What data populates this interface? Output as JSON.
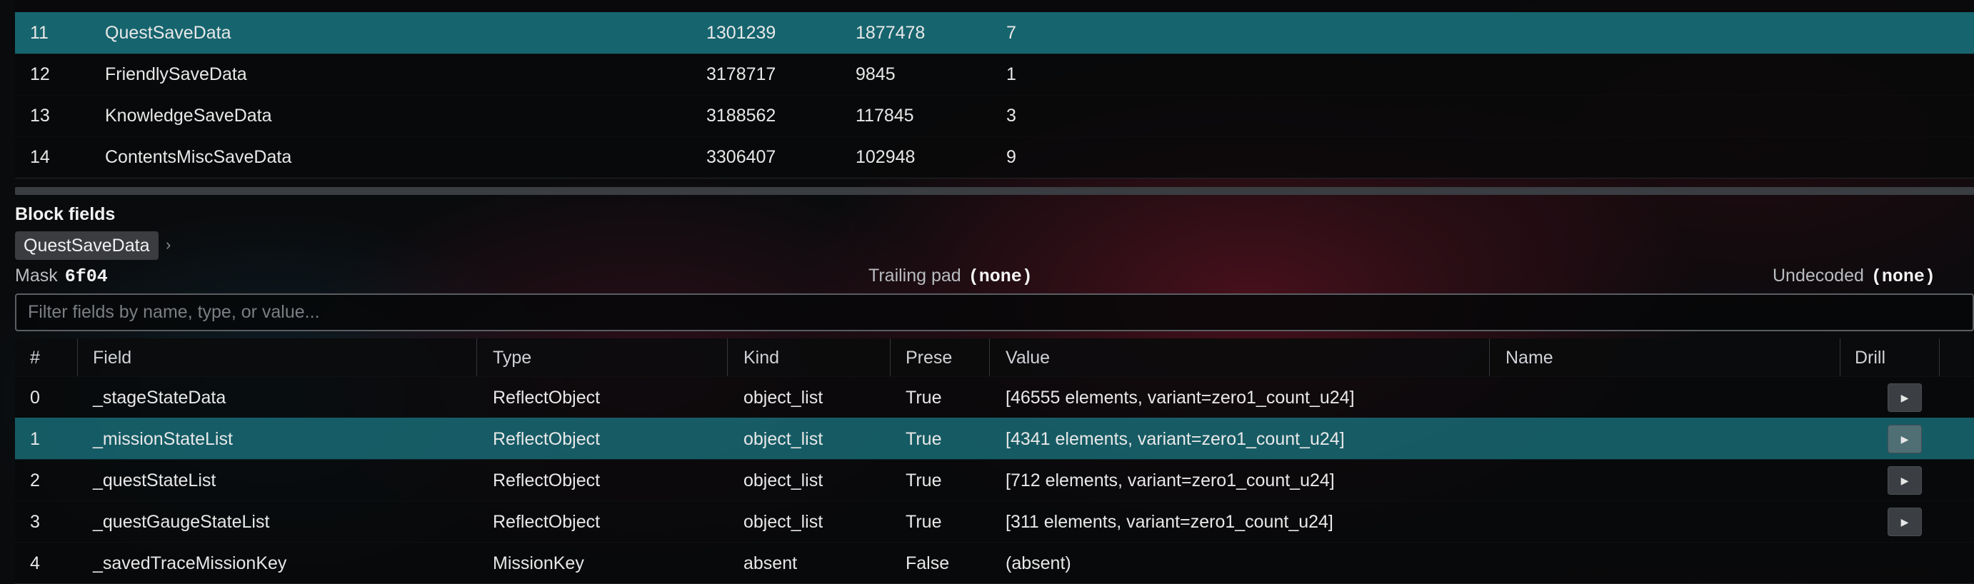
{
  "blocks": {
    "rows": [
      {
        "index": "11",
        "name": "QuestSaveData",
        "offset": "1301239",
        "size": "1877478",
        "count": "7",
        "selected": true
      },
      {
        "index": "12",
        "name": "FriendlySaveData",
        "offset": "3178717",
        "size": "9845",
        "count": "1"
      },
      {
        "index": "13",
        "name": "KnowledgeSaveData",
        "offset": "3188562",
        "size": "117845",
        "count": "3"
      },
      {
        "index": "14",
        "name": "ContentsMiscSaveData",
        "offset": "3306407",
        "size": "102948",
        "count": "9"
      }
    ]
  },
  "block_fields": {
    "title": "Block fields",
    "breadcrumb": "QuestSaveData",
    "breadcrumb_chevron": "›",
    "mask_label": "Mask",
    "mask_value": "6f04",
    "trailing_pad_label": "Trailing pad",
    "trailing_pad_value": "(none)",
    "undecoded_label": "Undecoded",
    "undecoded_value": "(none)",
    "filter_placeholder": "Filter fields by name, type, or value..."
  },
  "fields_table": {
    "columns": {
      "num": "#",
      "field": "Field",
      "type": "Type",
      "kind": "Kind",
      "present": "Prese",
      "value": "Value",
      "name": "Name",
      "drill": "Drill"
    },
    "drill_glyph": "▶",
    "rows": [
      {
        "num": "0",
        "field": "_stageStateData",
        "type": "ReflectObject",
        "kind": "object_list",
        "present": "True",
        "value": "[46555 elements, variant=zero1_count_u24]",
        "name": "",
        "has_drill": true
      },
      {
        "num": "1",
        "field": "_missionStateList",
        "type": "ReflectObject",
        "kind": "object_list",
        "present": "True",
        "value": "[4341 elements, variant=zero1_count_u24]",
        "name": "",
        "has_drill": true,
        "selected": true
      },
      {
        "num": "2",
        "field": "_questStateList",
        "type": "ReflectObject",
        "kind": "object_list",
        "present": "True",
        "value": "[712 elements, variant=zero1_count_u24]",
        "name": "",
        "has_drill": true
      },
      {
        "num": "3",
        "field": "_questGaugeStateList",
        "type": "ReflectObject",
        "kind": "object_list",
        "present": "True",
        "value": "[311 elements, variant=zero1_count_u24]",
        "name": "",
        "has_drill": true
      },
      {
        "num": "4",
        "field": "_savedTraceMissionKey",
        "type": "MissionKey",
        "kind": "absent",
        "present": "False",
        "value": "(absent)",
        "name": "",
        "has_drill": false
      }
    ]
  },
  "colors": {
    "selection": "#16646e",
    "background": "#0a0b0d"
  },
  "icons": {
    "drill": "play-triangle-icon",
    "breadcrumb_separator": "chevron-right-icon"
  }
}
